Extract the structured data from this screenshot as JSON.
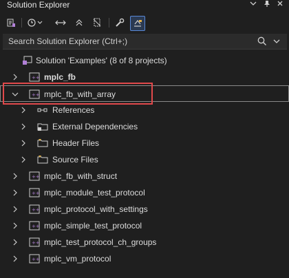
{
  "panel": {
    "title": "Solution Explorer"
  },
  "search": {
    "placeholder": "Search Solution Explorer (Ctrl+;)"
  },
  "tree": {
    "solution": "Solution 'Examples' (8 of 8 projects)",
    "projects": [
      {
        "label": "mplc_fb",
        "bold": true
      },
      {
        "label": "mplc_fb_with_array",
        "expanded": true
      },
      {
        "label": "References"
      },
      {
        "label": "External Dependencies"
      },
      {
        "label": "Header Files"
      },
      {
        "label": "Source Files"
      },
      {
        "label": "mplc_fb_with_struct"
      },
      {
        "label": "mplc_module_test_protocol"
      },
      {
        "label": "mplc_protocol_with_settings"
      },
      {
        "label": "mplc_simple_test_protocol"
      },
      {
        "label": "mplc_test_protocol_ch_groups"
      },
      {
        "label": "mplc_vm_protocol"
      }
    ]
  }
}
